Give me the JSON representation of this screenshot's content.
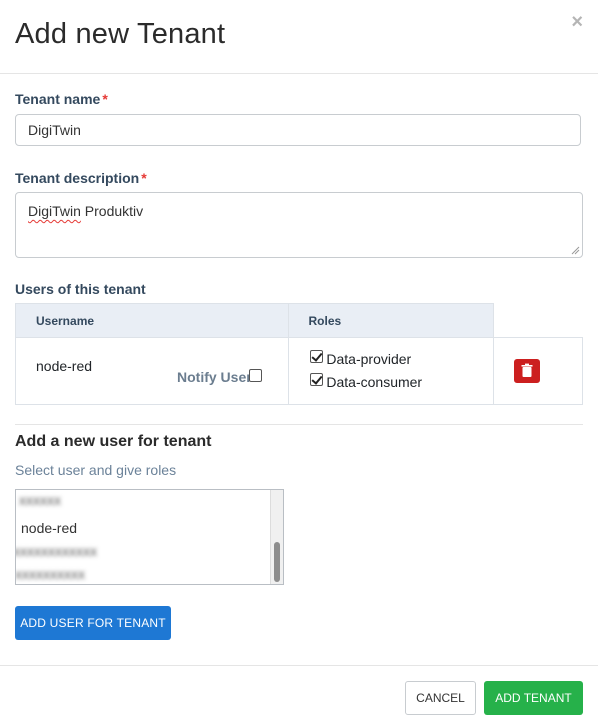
{
  "dialog": {
    "title": "Add new Tenant",
    "close_symbol": "×"
  },
  "form": {
    "tenant_name_label": "Tenant name",
    "required_mark": "*",
    "tenant_name_value": "DigiTwin",
    "tenant_description_label": "Tenant description",
    "tenant_description_value_word1": "DigiTwin",
    "tenant_description_value_word2": "Produktiv"
  },
  "users_table": {
    "section_label": "Users of this tenant",
    "columns": [
      "Username",
      "Roles"
    ],
    "rows": [
      {
        "username": "node-red",
        "notify_label": "Notify User",
        "notify_checked": false,
        "roles": [
          {
            "label": "Data-provider",
            "checked": true
          },
          {
            "label": "Data-consumer",
            "checked": true
          }
        ]
      }
    ]
  },
  "add_user": {
    "title": "Add a new user for tenant",
    "hint": "Select user and give roles",
    "list_items": [
      "xxxxxx",
      "node-red",
      "xxxxxxxxxxxx",
      "xxxxxxxxxx"
    ],
    "button_label": "ADD USER FOR TENANT"
  },
  "footer": {
    "cancel_label": "CANCEL",
    "submit_label": "ADD TENANT"
  },
  "colors": {
    "primary": "#1e78d4",
    "success": "#26b14a",
    "danger": "#cc1f1f",
    "required": "#e53935"
  }
}
